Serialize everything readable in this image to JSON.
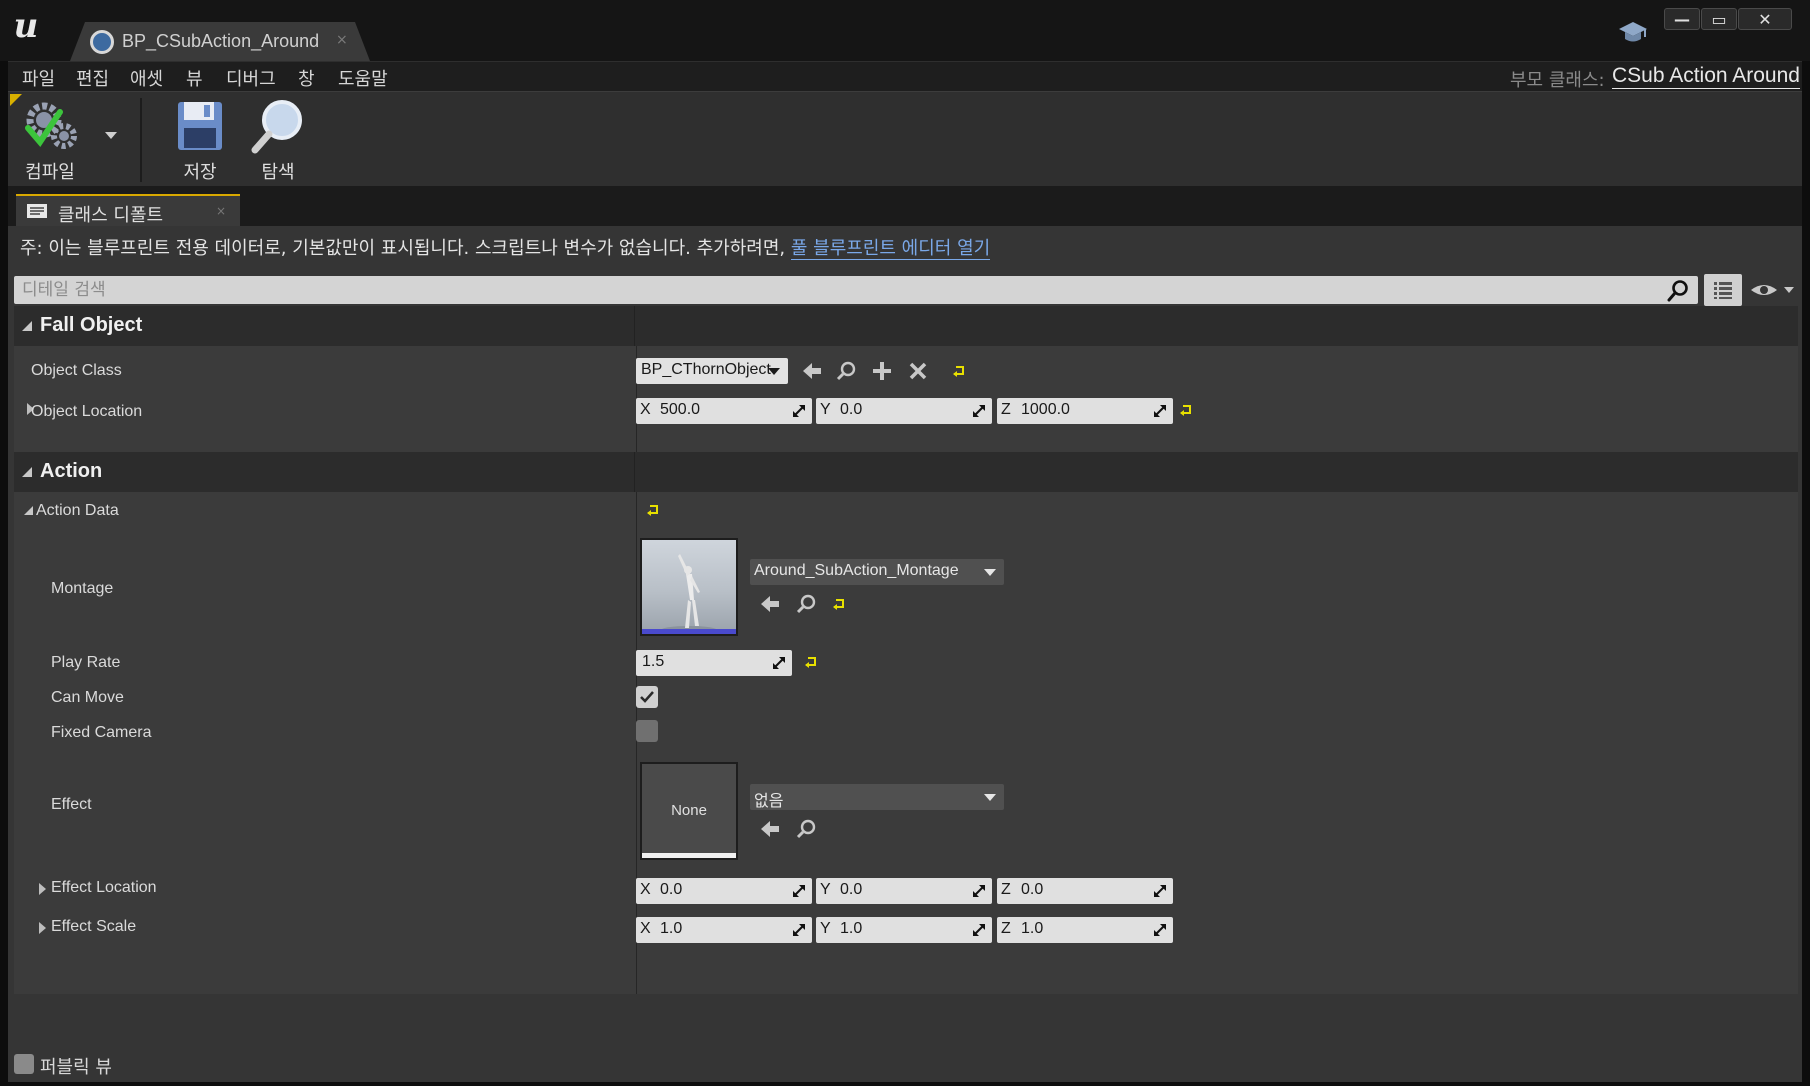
{
  "window": {
    "tab_title": "BP_CSubAction_Around",
    "tab_close": "×",
    "minimize": "—",
    "maximize": "▭",
    "close": "✕"
  },
  "menu": {
    "items": [
      "파일",
      "편집",
      "애셋",
      "뷰",
      "디버그",
      "창",
      "도움말"
    ],
    "parent_class_label": "부모 클래스:",
    "parent_class_value": "CSub Action Around"
  },
  "toolbar": {
    "compile_label": "컴파일",
    "save_label": "저장",
    "browse_label": "탐색"
  },
  "panel": {
    "tab_label": "클래스 디폴트",
    "tab_close": "×",
    "note_prefix": "주: 이는 블루프린트 전용 데이터로, 기본값만이 표시됩니다. 스크립트나 변수가 없습니다. 추가하려면,",
    "note_link": "풀 블루프린트 에디터 열기",
    "search_placeholder": "디테일 검색",
    "public_view_label": "퍼블릭 뷰"
  },
  "categories": {
    "fall_object": {
      "label": "Fall Object",
      "object_class": {
        "label": "Object Class",
        "value": "BP_CThornObject"
      },
      "object_location": {
        "label": "Object Location",
        "x": "500.0",
        "y": "0.0",
        "z": "1000.0"
      }
    },
    "action": {
      "label": "Action",
      "action_data": {
        "label": "Action Data"
      },
      "montage": {
        "label": "Montage",
        "value": "Around_SubAction_Montage"
      },
      "play_rate": {
        "label": "Play Rate",
        "value": "1.5"
      },
      "can_move": {
        "label": "Can Move",
        "checked": true
      },
      "fixed_camera": {
        "label": "Fixed Camera",
        "checked": false
      },
      "effect": {
        "label": "Effect",
        "value": "없음",
        "thumb_label": "None"
      },
      "effect_location": {
        "label": "Effect Location",
        "x": "0.0",
        "y": "0.0",
        "z": "0.0"
      },
      "effect_scale": {
        "label": "Effect Scale",
        "x": "1.0",
        "y": "1.0",
        "z": "1.0"
      }
    }
  },
  "axis_labels": {
    "x": "X",
    "y": "Y",
    "z": "Z"
  },
  "colors": {
    "accent_yellow": "#d8b000",
    "link_blue": "#7aa8e8",
    "reset_yellow": "#e8e000"
  },
  "icons": [
    "ue-logo-icon",
    "blueprint-class-icon",
    "learn-cap-icon",
    "compile-gear-icon",
    "save-disk-icon",
    "browse-magnifier-icon",
    "details-panel-icon",
    "search-icon",
    "list-view-icon",
    "eye-icon",
    "arrow-left-icon",
    "magnifier-icon",
    "plus-icon",
    "clear-x-icon",
    "reset-arrow-icon",
    "drag-arrows-icon",
    "checkmark-icon"
  ]
}
